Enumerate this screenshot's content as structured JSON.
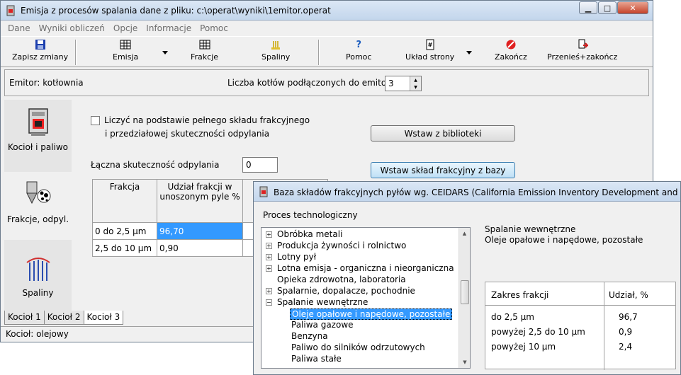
{
  "main_window": {
    "title": "Emisja z procesów spalania   dane z pliku: c:\\operat\\wyniki\\1emitor.operat",
    "menu": [
      "Dane",
      "Wyniki obliczeń",
      "Opcje",
      "Informacje",
      "Pomoc"
    ],
    "toolbar": {
      "save": "Zapisz zmiany",
      "emisja": "Emisja",
      "frakcje": "Frakcje",
      "spaliny": "Spaliny",
      "pomoc": "Pomoc",
      "uklad": "Układ strony",
      "zakoncz": "Zakończ",
      "przenies": "Przenieś+zakończ"
    },
    "emitor_label": "Emitor: kotłownia",
    "liczba_label": "Liczba kotłów podłączonych do emitora",
    "liczba_value": "3",
    "sidebar": [
      "Kocioł i  paliwo",
      "Frakcje, odpyl.",
      "Spaliny"
    ],
    "checkbox_line1": "Liczyć na podstawie pełnego składu frakcyjnego",
    "checkbox_line2": "i  przedziałowej skuteczności odpylania",
    "btn_biblioteka": "Wstaw z biblioteki",
    "btn_baza": "Wstaw skład frakcyjny z bazy",
    "laczna_label": "Łączna skuteczność odpylania",
    "laczna_value": "0",
    "grid": {
      "headers": [
        "Frakcja",
        "Udział frakcji w unoszonym pyle %"
      ],
      "rows": [
        [
          "0 do 2,5 µm",
          "96,70"
        ],
        [
          "2,5 do 10 µm",
          "0,90"
        ]
      ]
    },
    "tabs": [
      "Kocioł 1",
      "Kocioł 2",
      "Kocioł 3"
    ],
    "status": "Kocioł: olejowy"
  },
  "dialog": {
    "title": "Baza składów frakcyjnych pyłów wg. CEIDARS (California Emission Inventory Development and Reporting Systems)",
    "proc_label": "Proces technologiczny",
    "tree": [
      {
        "label": "Obróbka metali",
        "level": 0,
        "expander": "+"
      },
      {
        "label": "Produkcja żywności i rolnictwo",
        "level": 0,
        "expander": "+"
      },
      {
        "label": "Lotny pył",
        "level": 0,
        "expander": "+"
      },
      {
        "label": "Lotna emisja - organiczna i nieorganiczna",
        "level": 0,
        "expander": "+"
      },
      {
        "label": "Opieka zdrowotna, laboratoria",
        "level": 0,
        "expander": ""
      },
      {
        "label": "Spalarnie, dopalacze, pochodnie",
        "level": 0,
        "expander": "+"
      },
      {
        "label": "Spalanie wewnętrzne",
        "level": 0,
        "expander": "-"
      },
      {
        "label": "Oleje opałowe i napędowe, pozostałe",
        "level": 1,
        "expander": "",
        "selected": true
      },
      {
        "label": "Paliwa gazowe",
        "level": 1,
        "expander": ""
      },
      {
        "label": "Benzyna",
        "level": 1,
        "expander": ""
      },
      {
        "label": "Paliwo do silników odrzutowych",
        "level": 1,
        "expander": ""
      },
      {
        "label": "Paliwa stałe",
        "level": 1,
        "expander": ""
      }
    ],
    "desc_line1": "Spalanie wewnętrzne",
    "desc_line2": "Oleje opałowe i napędowe, pozostałe",
    "table": {
      "headers": [
        "Zakres frakcji",
        "Udział, %"
      ],
      "rows": [
        [
          "do 2,5 µm",
          "96,7"
        ],
        [
          "powyżej 2,5 do 10 µm",
          "0,9"
        ],
        [
          "powyżej 10 µm",
          "2,4"
        ]
      ]
    }
  }
}
